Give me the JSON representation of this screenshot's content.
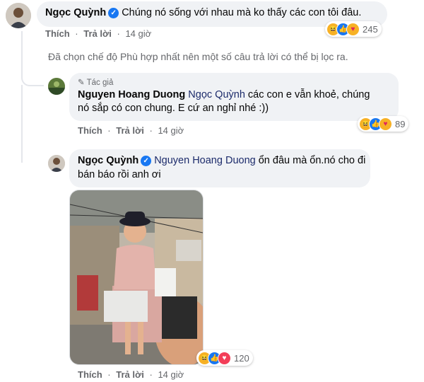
{
  "comment1": {
    "author": "Ngọc Quỳnh",
    "text": "Chúng nó sống với nhau mà ko thấy các con tôi đâu.",
    "like": "Thích",
    "reply": "Trả lời",
    "time": "14 giờ",
    "reactions": [
      "haha",
      "like",
      "care"
    ],
    "reaction_count": "245"
  },
  "filter_notice": "Đã chọn chế độ Phù hợp nhất nên một số câu trả lời có thể bị lọc ra.",
  "reply1": {
    "badge": "Tác giả",
    "author": "Nguyen Hoang Duong",
    "mention": "Ngọc Quỳnh",
    "text_line1": "các con e vẫn khoẻ, chúng",
    "text_line2": "nó sắp có con chung. E cứ an nghỉ nhé :))",
    "like": "Thích",
    "reply": "Trả lời",
    "time": "14 giờ",
    "reactions": [
      "haha",
      "like",
      "care"
    ],
    "reaction_count": "89"
  },
  "reply2": {
    "author": "Ngọc Quỳnh",
    "mention": "Nguyen Hoang Duong",
    "text_line1": "ổn đâu mà ổn.nó cho đi",
    "text_line2": "bán báo rồi anh ơi",
    "like": "Thích",
    "reply": "Trả lời",
    "time": "14 giờ",
    "reactions": [
      "haha",
      "like",
      "love"
    ],
    "reaction_count": "120"
  },
  "colors": {
    "bubble": "#f0f2f5",
    "verified": "#1877f2",
    "meta_text": "#65676b"
  }
}
